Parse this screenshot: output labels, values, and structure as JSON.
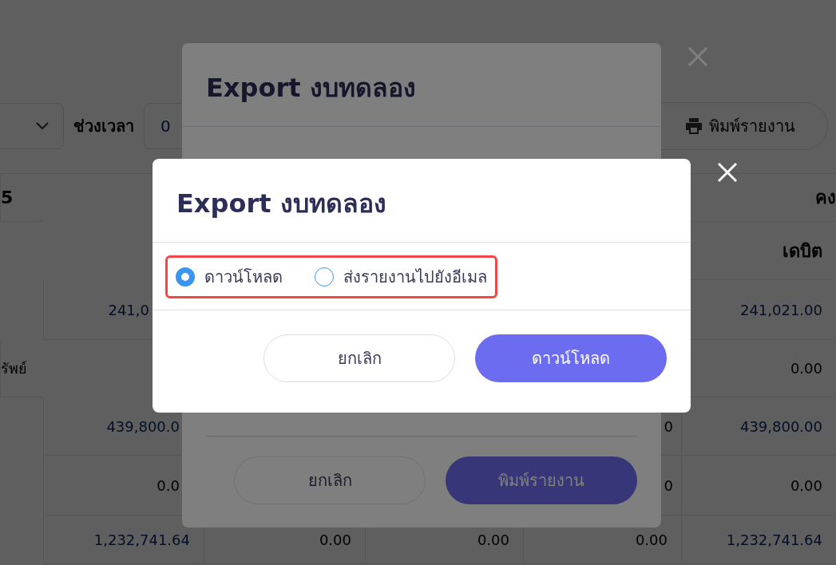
{
  "toolbar": {
    "period_label": "ช่วงเวลา",
    "date_value": "0",
    "print_button": "พิมพ์รายงาน"
  },
  "table": {
    "header": {
      "column_1": "5",
      "column_6": "คง"
    },
    "subheader": {
      "column_6": "เดบิต"
    },
    "rows": [
      {
        "column_2": "241,0",
        "column_6": "241,021.00"
      },
      {
        "column_1": "รัพย์",
        "column_6": "0.00"
      },
      {
        "column_2": "439,800.0",
        "column_5": "0",
        "column_6": "439,800.00"
      },
      {
        "column_2": "0.0",
        "column_5": "0",
        "column_6": "0.00"
      },
      {
        "column_2": "1,232,741.64",
        "column_3": "0.00",
        "column_4": "0.00",
        "column_5": "0.00",
        "column_6": "1,232,741.64"
      }
    ]
  },
  "back_dialog": {
    "title": "Export งบทดลอง",
    "cancel": "ยกเลิก",
    "confirm": "พิมพ์รายงาน"
  },
  "dialog": {
    "title": "Export งบทดลอง",
    "options": [
      {
        "label": "ดาวน์โหลด",
        "selected": true
      },
      {
        "label": "ส่งรายงานไปยังอีเมล",
        "selected": false
      }
    ],
    "cancel": "ยกเลิก",
    "confirm": "ดาวน์โหลด"
  }
}
